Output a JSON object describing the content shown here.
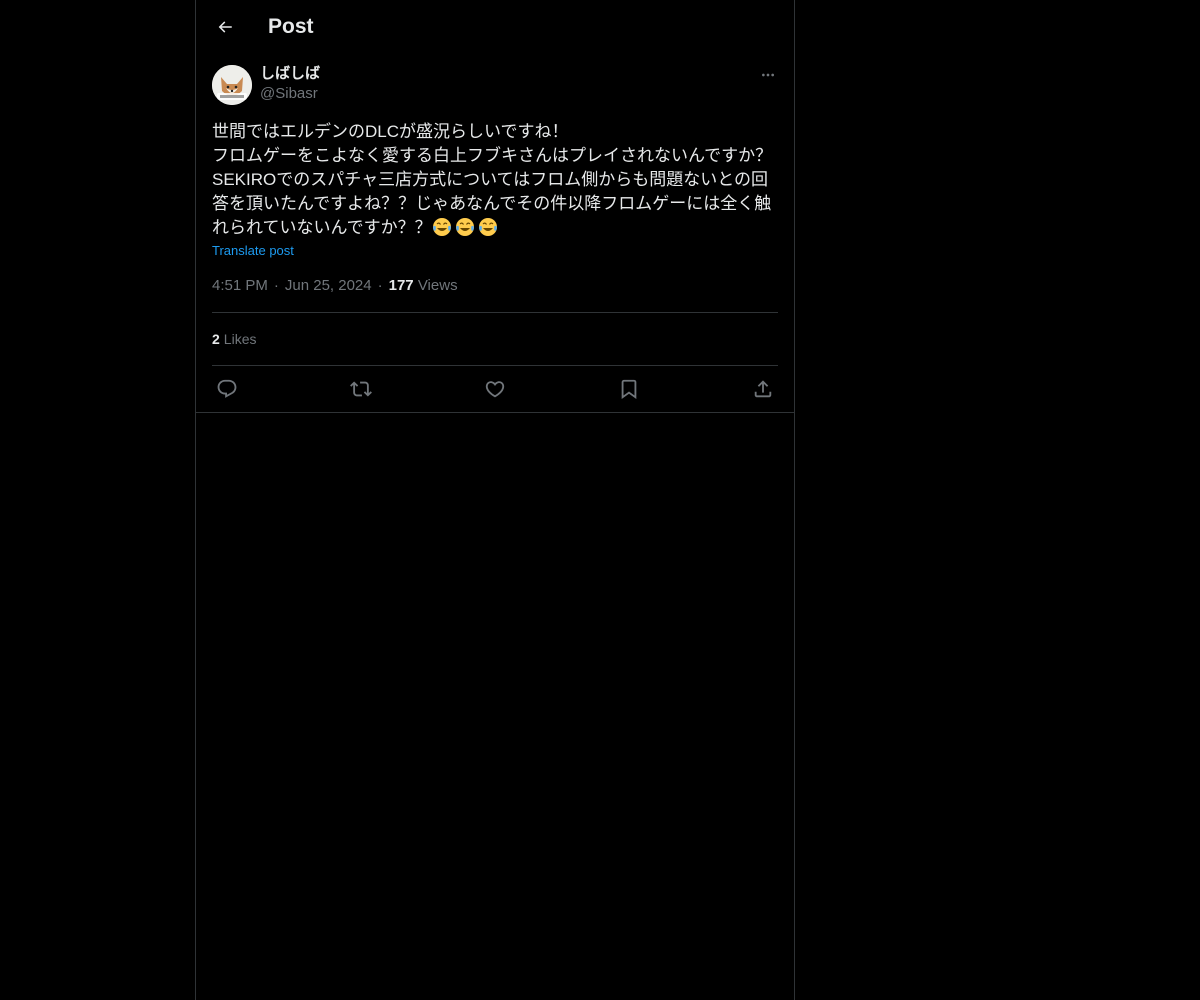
{
  "header": {
    "title": "Post",
    "back_icon": "arrow-left-icon"
  },
  "author": {
    "display_name": "しばしば",
    "handle": "@Sibasr",
    "avatar_icon": "fox-avatar"
  },
  "post": {
    "text": "世間ではエルデンのDLCが盛況らしいですね！\nフロムゲーをこよなく愛する白上フブキさんはプレイされないんですか？\nSEKIROでのスパチャ三店方式についてはフロム側からも問題ないとの回答を頂いたんですよね？？じゃあなんでその件以降フロムゲーには全く触れられていないんですか？？",
    "emoji": [
      "😂",
      "😂",
      "😂"
    ],
    "translate_label": "Translate post",
    "time": "4:51 PM",
    "date": "Jun 25, 2024",
    "views_count": "177",
    "views_label": "Views",
    "separator": "·"
  },
  "stats": {
    "likes_count": "2",
    "likes_label": "Likes"
  },
  "actions": [
    {
      "icon": "reply-icon"
    },
    {
      "icon": "repost-icon"
    },
    {
      "icon": "like-icon"
    },
    {
      "icon": "bookmark-icon"
    },
    {
      "icon": "share-icon"
    }
  ],
  "colors": {
    "background": "#000000",
    "text": "#e7e9ea",
    "secondary": "#71767b",
    "link": "#1d9bf0",
    "border": "#2f3336"
  }
}
